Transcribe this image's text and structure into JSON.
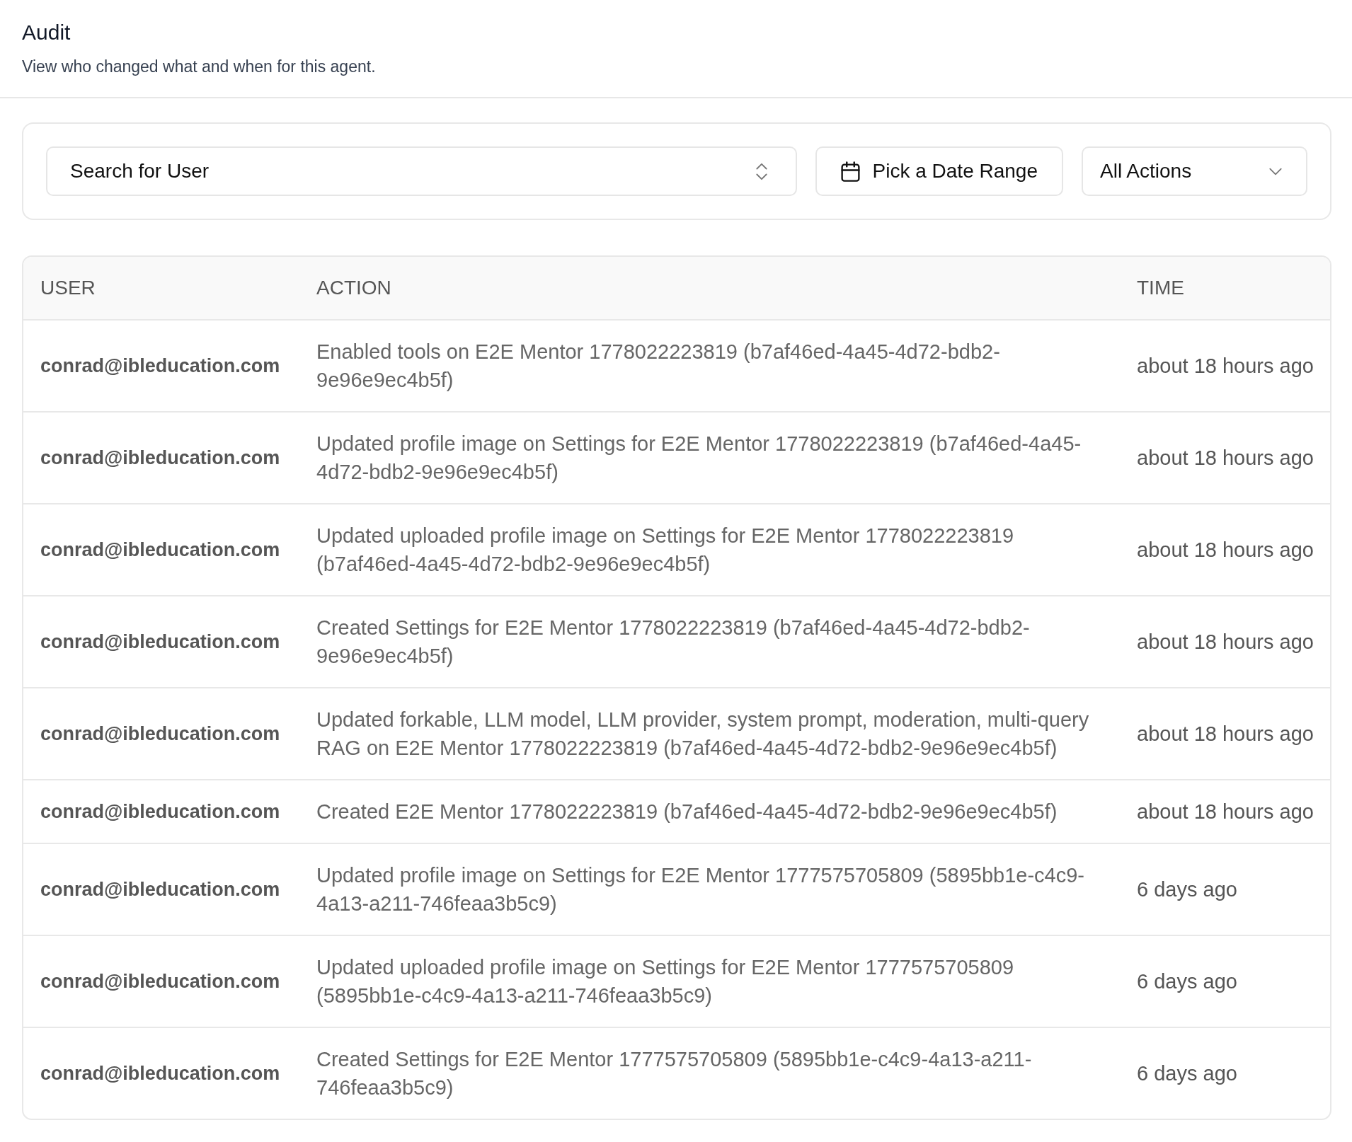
{
  "header": {
    "title": "Audit",
    "subtitle": "View who changed what and when for this agent."
  },
  "filters": {
    "user_search": {
      "label": "Search for User"
    },
    "date_range": {
      "label": "Pick a Date Range"
    },
    "action_filter": {
      "value": "All Actions"
    }
  },
  "table": {
    "columns": [
      "USER",
      "ACTION",
      "TIME"
    ],
    "rows": [
      {
        "user": "conrad@ibleducation.com",
        "action": "Enabled tools on E2E Mentor 1778022223819 (b7af46ed-4a45-4d72-bdb2-9e96e9ec4b5f)",
        "time": "about 18 hours ago"
      },
      {
        "user": "conrad@ibleducation.com",
        "action": "Updated profile image on Settings for E2E Mentor 1778022223819 (b7af46ed-4a45-4d72-bdb2-9e96e9ec4b5f)",
        "time": "about 18 hours ago"
      },
      {
        "user": "conrad@ibleducation.com",
        "action": "Updated uploaded profile image on Settings for E2E Mentor 1778022223819 (b7af46ed-4a45-4d72-bdb2-9e96e9ec4b5f)",
        "time": "about 18 hours ago"
      },
      {
        "user": "conrad@ibleducation.com",
        "action": "Created Settings for E2E Mentor 1778022223819 (b7af46ed-4a45-4d72-bdb2-9e96e9ec4b5f)",
        "time": "about 18 hours ago"
      },
      {
        "user": "conrad@ibleducation.com",
        "action": "Updated forkable, LLM model, LLM provider, system prompt, moderation, multi-query RAG on E2E Mentor 1778022223819 (b7af46ed-4a45-4d72-bdb2-9e96e9ec4b5f)",
        "time": "about 18 hours ago"
      },
      {
        "user": "conrad@ibleducation.com",
        "action": "Created E2E Mentor 1778022223819 (b7af46ed-4a45-4d72-bdb2-9e96e9ec4b5f)",
        "time": "about 18 hours ago"
      },
      {
        "user": "conrad@ibleducation.com",
        "action": "Updated profile image on Settings for E2E Mentor 1777575705809 (5895bb1e-c4c9-4a13-a211-746feaa3b5c9)",
        "time": "6 days ago"
      },
      {
        "user": "conrad@ibleducation.com",
        "action": "Updated uploaded profile image on Settings for E2E Mentor 1777575705809 (5895bb1e-c4c9-4a13-a211-746feaa3b5c9)",
        "time": "6 days ago"
      },
      {
        "user": "conrad@ibleducation.com",
        "action": "Created Settings for E2E Mentor 1777575705809 (5895bb1e-c4c9-4a13-a211-746feaa3b5c9)",
        "time": "6 days ago"
      }
    ]
  }
}
